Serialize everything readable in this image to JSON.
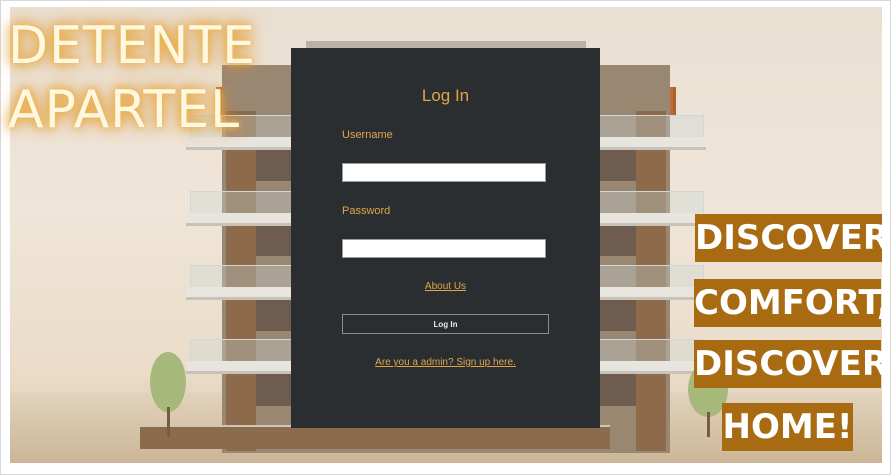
{
  "brand": {
    "line1": "DETENTE",
    "line2": "APARTEL"
  },
  "tagline": {
    "lines": [
      "DISCOVER",
      "COMFORT,",
      "DISCOVER",
      "HOME!"
    ]
  },
  "login": {
    "title": "Log In",
    "username_label": "Username",
    "username_value": "",
    "password_label": "Password",
    "password_value": "",
    "about_link": "About Us",
    "submit_label": "Log In",
    "signup_link": "Are you a admin? Sign up here."
  },
  "colors": {
    "panel": "#2b2e31",
    "accent": "#e0a54a",
    "tag_bg": "#a86b12"
  }
}
